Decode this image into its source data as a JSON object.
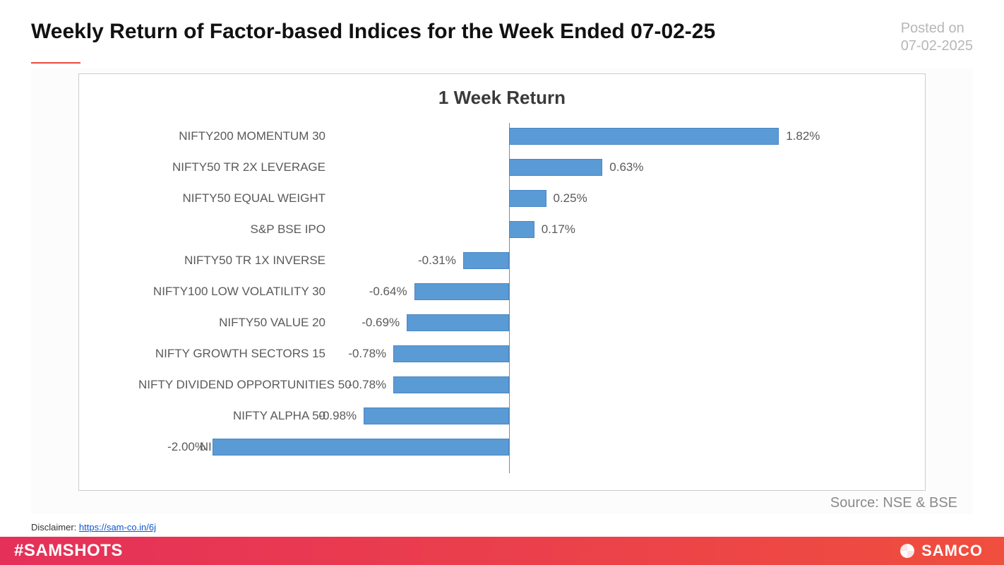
{
  "header": {
    "title": "Weekly Return of Factor-based Indices for the Week Ended 07-02-25",
    "posted_label": "Posted on",
    "posted_date": "07-02-2025"
  },
  "chart_data": {
    "type": "bar",
    "orientation": "horizontal",
    "title": "1 Week Return",
    "xlabel": "",
    "ylabel": "",
    "xlim": [
      -2.5,
      2.5
    ],
    "categories": [
      "NIFTY200 MOMENTUM 30",
      "NIFTY50 TR 2X LEVERAGE",
      "NIFTY50 EQUAL WEIGHT",
      "S&P BSE IPO",
      "NIFTY50 TR 1X INVERSE",
      "NIFTY100 LOW VOLATILITY 30",
      "NIFTY50 VALUE 20",
      "NIFTY GROWTH SECTORS 15",
      "NIFTY DIVIDEND OPPORTUNITIES 50",
      "NIFTY ALPHA 50",
      "NIFTY200 QUALITY 30"
    ],
    "values": [
      1.82,
      0.63,
      0.25,
      0.17,
      -0.31,
      -0.64,
      -0.69,
      -0.78,
      -0.78,
      -0.98,
      -2.0
    ],
    "value_labels": [
      "1.82%",
      "0.63%",
      "0.25%",
      "0.17%",
      "-0.31%",
      "-0.64%",
      "-0.69%",
      "-0.78%",
      "-0.78%",
      "-0.98%",
      "-2.00%"
    ],
    "bar_color": "#5a9bd5",
    "source": "Source: NSE & BSE"
  },
  "disclaimer": {
    "label": "Disclaimer:",
    "link_text": "https://sam-co.in/6j"
  },
  "footer": {
    "hashtag": "#SAMSHOTS",
    "brand": "SAMCO"
  }
}
